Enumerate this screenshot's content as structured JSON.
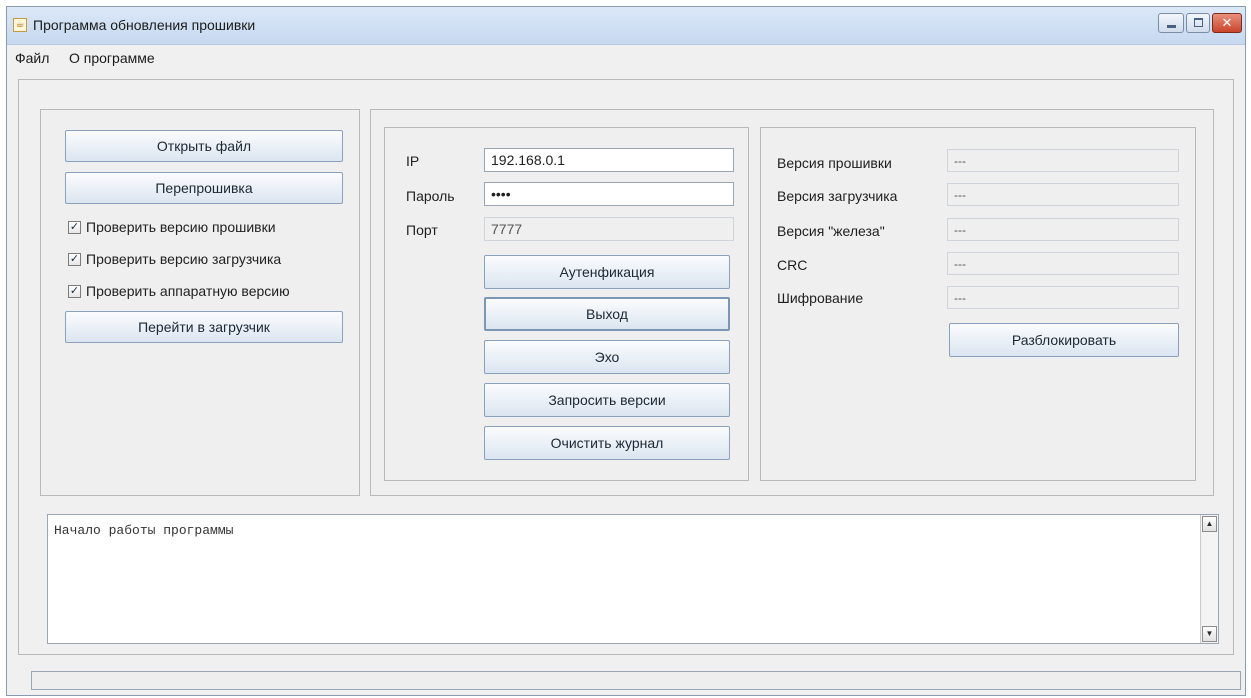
{
  "window": {
    "title": "Программа обновления прошивки"
  },
  "menubar": {
    "items": [
      {
        "label": "Файл"
      },
      {
        "label": "О программе"
      }
    ]
  },
  "left_panel": {
    "open_file_label": "Открыть файл",
    "reflash_label": "Перепрошивка",
    "checkboxes": [
      {
        "label": "Проверить версию прошивки",
        "checked": true
      },
      {
        "label": "Проверить версию загрузчика",
        "checked": true
      },
      {
        "label": "Проверить аппаратную версию",
        "checked": true
      }
    ],
    "goto_bootloader_label": "Перейти в загрузчик"
  },
  "connection": {
    "ip_label": "IP",
    "ip_value": "192.168.0.1",
    "password_label": "Пароль",
    "password_value": "1234",
    "port_label": "Порт",
    "port_value": "7777",
    "auth_label": "Аутенфикация",
    "exit_label": "Выход",
    "echo_label": "Эхо",
    "request_versions_label": "Запросить версии",
    "clear_log_label": "Очистить журнал"
  },
  "info": {
    "firmware_version_label": "Версия прошивки",
    "firmware_version_value": "---",
    "bootloader_version_label": "Версия загрузчика",
    "bootloader_version_value": "---",
    "hardware_version_label": "Версия \"железа\"",
    "hardware_version_value": "---",
    "crc_label": "CRC",
    "crc_value": "---",
    "encryption_label": "Шифрование",
    "encryption_value": "---",
    "unlock_label": "Разблокировать"
  },
  "log": {
    "text": "Начало работы программы"
  },
  "progress": {
    "value_percent": 0
  },
  "colors": {
    "accent": "#3f7fd0",
    "titlebar": "#c6d9f0",
    "close_button": "#c8452b"
  },
  "icons": {
    "app": "java-app-icon",
    "check": "checkmark-icon",
    "scroll_up": "arrow-up-icon",
    "scroll_down": "arrow-down-icon"
  }
}
